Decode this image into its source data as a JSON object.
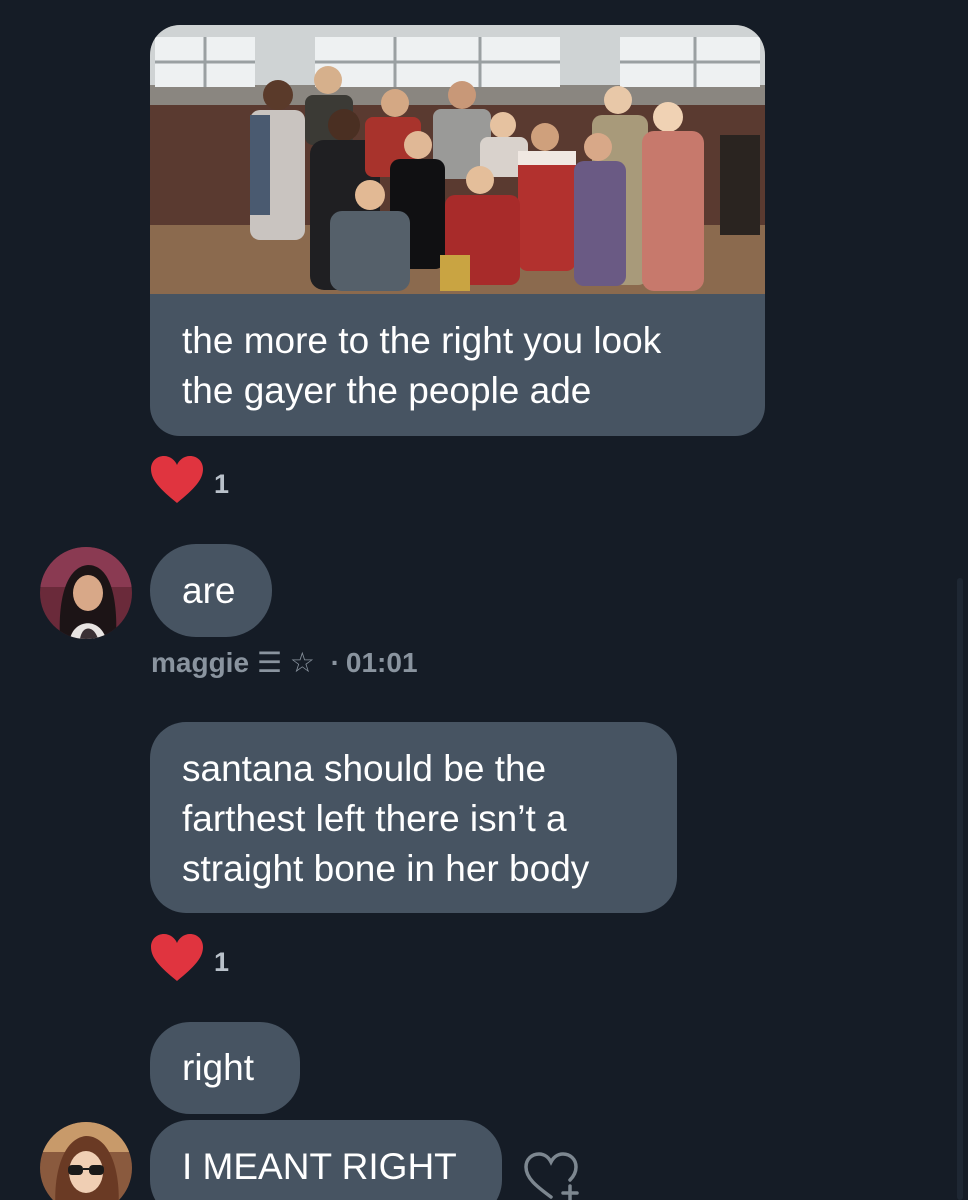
{
  "colors": {
    "background": "#151c26",
    "bubble": "#475462",
    "text": "#ffffff",
    "meta_text": "#8a949f",
    "reaction_heart": "#e0343f"
  },
  "messages": [
    {
      "type": "image-with-caption",
      "caption": "the more to the right you look\nthe gayer the people ade",
      "reaction": {
        "icon": "heart-filled-icon",
        "count": "1"
      }
    },
    {
      "type": "text",
      "text": "are",
      "author": "maggie",
      "author_badges": "☰ ☆",
      "timestamp": "01:01"
    },
    {
      "type": "text",
      "text": "santana should be the\nfarthest left there isn’t a\nstraight bone in her body",
      "reaction": {
        "icon": "heart-filled-icon",
        "count": "1"
      }
    },
    {
      "type": "text",
      "text": "right"
    },
    {
      "type": "text",
      "text": "I MEANT RIGHT",
      "action_icon": "add-reaction-heart-icon"
    }
  ]
}
